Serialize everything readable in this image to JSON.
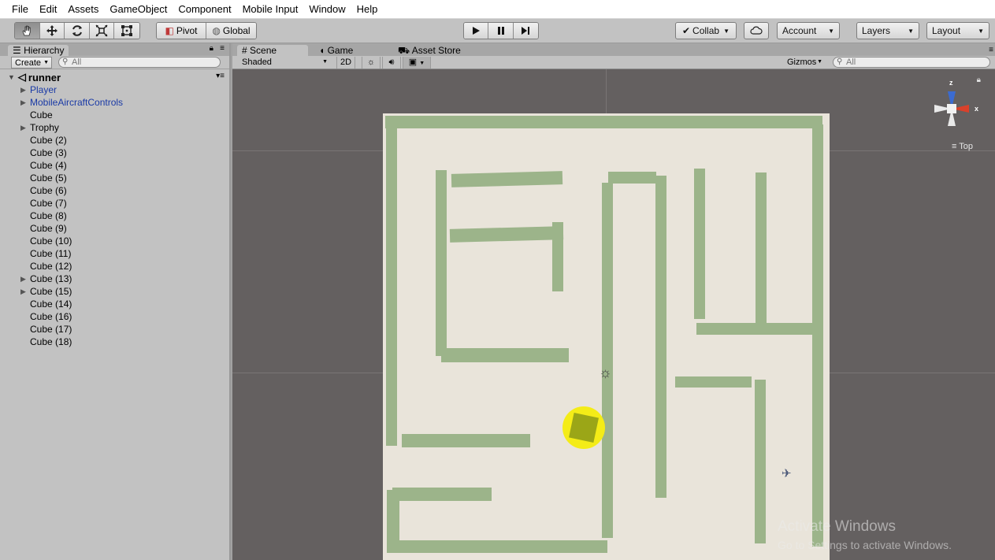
{
  "menubar": {
    "items": [
      "File",
      "Edit",
      "Assets",
      "GameObject",
      "Component",
      "Mobile Input",
      "Window",
      "Help"
    ]
  },
  "toolbar": {
    "transform_tools": [
      "hand-tool-icon",
      "move-tool-icon",
      "rotate-tool-icon",
      "scale-tool-icon",
      "rect-tool-icon"
    ],
    "pivot_label": "Pivot",
    "global_label": "Global",
    "play_icons": [
      "play-icon",
      "pause-icon",
      "step-icon"
    ],
    "collab_label": "Collab",
    "account_label": "Account",
    "layers_label": "Layers",
    "layout_label": "Layout"
  },
  "hierarchy": {
    "tab_label": "Hierarchy",
    "create_label": "Create",
    "search_placeholder": "All",
    "scene_name": "runner",
    "items": [
      {
        "label": "Player",
        "prefab": true,
        "expandable": true
      },
      {
        "label": "MobileAircraftControls",
        "prefab": true,
        "expandable": true
      },
      {
        "label": "Cube",
        "prefab": false,
        "expandable": false
      },
      {
        "label": "Trophy",
        "prefab": false,
        "expandable": true
      },
      {
        "label": "Cube (2)",
        "prefab": false,
        "expandable": false
      },
      {
        "label": "Cube (3)",
        "prefab": false,
        "expandable": false
      },
      {
        "label": "Cube (4)",
        "prefab": false,
        "expandable": false
      },
      {
        "label": "Cube (5)",
        "prefab": false,
        "expandable": false
      },
      {
        "label": "Cube (6)",
        "prefab": false,
        "expandable": false
      },
      {
        "label": "Cube (7)",
        "prefab": false,
        "expandable": false
      },
      {
        "label": "Cube (8)",
        "prefab": false,
        "expandable": false
      },
      {
        "label": "Cube (9)",
        "prefab": false,
        "expandable": false
      },
      {
        "label": "Cube (10)",
        "prefab": false,
        "expandable": false
      },
      {
        "label": "Cube (11)",
        "prefab": false,
        "expandable": false
      },
      {
        "label": "Cube (12)",
        "prefab": false,
        "expandable": false
      },
      {
        "label": "Cube (13)",
        "prefab": false,
        "expandable": true
      },
      {
        "label": "Cube (15)",
        "prefab": false,
        "expandable": true
      },
      {
        "label": "Cube (14)",
        "prefab": false,
        "expandable": false
      },
      {
        "label": "Cube (16)",
        "prefab": false,
        "expandable": false
      },
      {
        "label": "Cube (17)",
        "prefab": false,
        "expandable": false
      },
      {
        "label": "Cube (18)",
        "prefab": false,
        "expandable": false
      }
    ]
  },
  "scene": {
    "tabs": [
      "Scene",
      "Game",
      "Asset Store"
    ],
    "shading_mode": "Shaded",
    "mode_2d": "2D",
    "gizmos_label": "Gizmos",
    "search_placeholder": "All",
    "view_label": "Top",
    "axis_labels": {
      "z": "z",
      "x": "x"
    }
  },
  "watermark": {
    "line1": "Activate Windows",
    "line2": "Go to Settings to activate Windows."
  },
  "colors": {
    "viewport_bg": "#646060",
    "floor": "#e9e4da",
    "walls": "#9cb48a",
    "trophy": "#f4ec17",
    "prefab_text": "#1a3aa6"
  }
}
